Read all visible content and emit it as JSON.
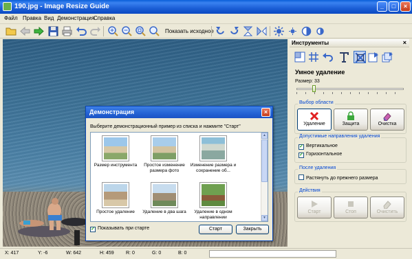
{
  "window": {
    "title": "190.jpg - Image Resize Guide",
    "minimize": "_",
    "maximize": "□",
    "close": "×"
  },
  "menu": [
    "Файл",
    "Правка",
    "Вид",
    "Демонстрация",
    "Справка"
  ],
  "toolbar": {
    "show_original": "Показать исходное"
  },
  "panel": {
    "header": "Инструменты",
    "close": "×",
    "section_title": "Умное удаление",
    "size_label": "Размер: 33",
    "size_value": 33,
    "area_group": {
      "label": "Выбор области",
      "buttons": [
        "Удаление",
        "Защита",
        "Очистка"
      ]
    },
    "directions_group": {
      "label": "Допустимые направления удаления",
      "options": [
        {
          "label": "Вертикальное",
          "checked": true
        },
        {
          "label": "Горизонтальное",
          "checked": true
        }
      ]
    },
    "after_group": {
      "label": "После удаления",
      "option": {
        "label": "Растянуть до прежнего размера",
        "checked": false
      }
    },
    "actions_group": {
      "label": "Действия",
      "buttons": [
        "Старт",
        "Стоп",
        "Очистить"
      ]
    }
  },
  "modal": {
    "title": "Демонстрация",
    "close": "×",
    "prompt": "Выберите демонстрационный пример из списка и нажмите \"Старт\"",
    "examples": [
      {
        "caption": "Размер инструмента"
      },
      {
        "caption": "Простое изменение размера фото"
      },
      {
        "caption": "Изменение размера и сохранение об..."
      },
      {
        "caption": "Простое удаление"
      },
      {
        "caption": "Удаление в два шага"
      },
      {
        "caption": "Удаление в одном направлении"
      }
    ],
    "show_at_start": "Показывать при старте",
    "show_at_start_checked": true,
    "start_button": "Старт",
    "close_button": "Закрыть"
  },
  "status": {
    "x": "X: 417",
    "y": "Y: -6",
    "w": "W: 642",
    "h": "H: 459",
    "r": "R: 0",
    "g": "G: 0",
    "b": "B: 0"
  },
  "colors": {
    "titlebar": "#1c5fd6",
    "accent": "#0046d5",
    "delete_red": "#e02020",
    "protect_green": "#3ca83c"
  }
}
